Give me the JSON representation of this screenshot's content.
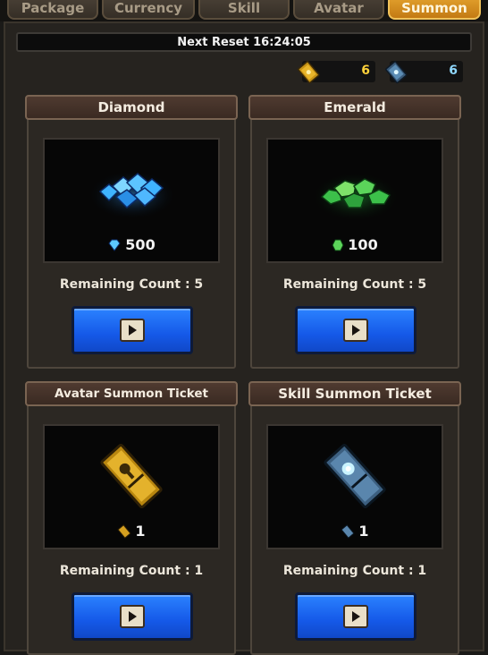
{
  "tabs": [
    {
      "label": "Package",
      "active": false
    },
    {
      "label": "Currency",
      "active": false
    },
    {
      "label": "Skill",
      "active": false
    },
    {
      "label": "Avatar",
      "active": false
    },
    {
      "label": "Summon",
      "active": true
    }
  ],
  "reset": {
    "text": "Next Reset 16:24:05"
  },
  "counters": {
    "avatar_ticket": {
      "value": "6",
      "icon": "gold-ticket-icon",
      "color": "#ffd23a"
    },
    "skill_ticket": {
      "value": "6",
      "icon": "blue-ticket-icon",
      "color": "#8fd8ff"
    }
  },
  "cards": [
    {
      "title": "Diamond",
      "price": "500",
      "price_icon": "diamond-icon",
      "remaining": "Remaining Count : 5",
      "item": "diamond-pile-icon"
    },
    {
      "title": "Emerald",
      "price": "100",
      "price_icon": "emerald-icon",
      "remaining": "Remaining Count : 5",
      "item": "emerald-pile-icon"
    },
    {
      "title": "Avatar Summon Ticket",
      "price": "1",
      "price_icon": "gold-ticket-icon",
      "remaining": "Remaining Count : 1",
      "item": "gold-ticket-icon"
    },
    {
      "title": "Skill Summon Ticket",
      "price": "1",
      "price_icon": "blue-ticket-icon",
      "remaining": "Remaining Count : 1",
      "item": "blue-ticket-icon"
    }
  ],
  "colors": {
    "accent_tab": "#d98f1e",
    "button_blue": "#1f66f0"
  }
}
